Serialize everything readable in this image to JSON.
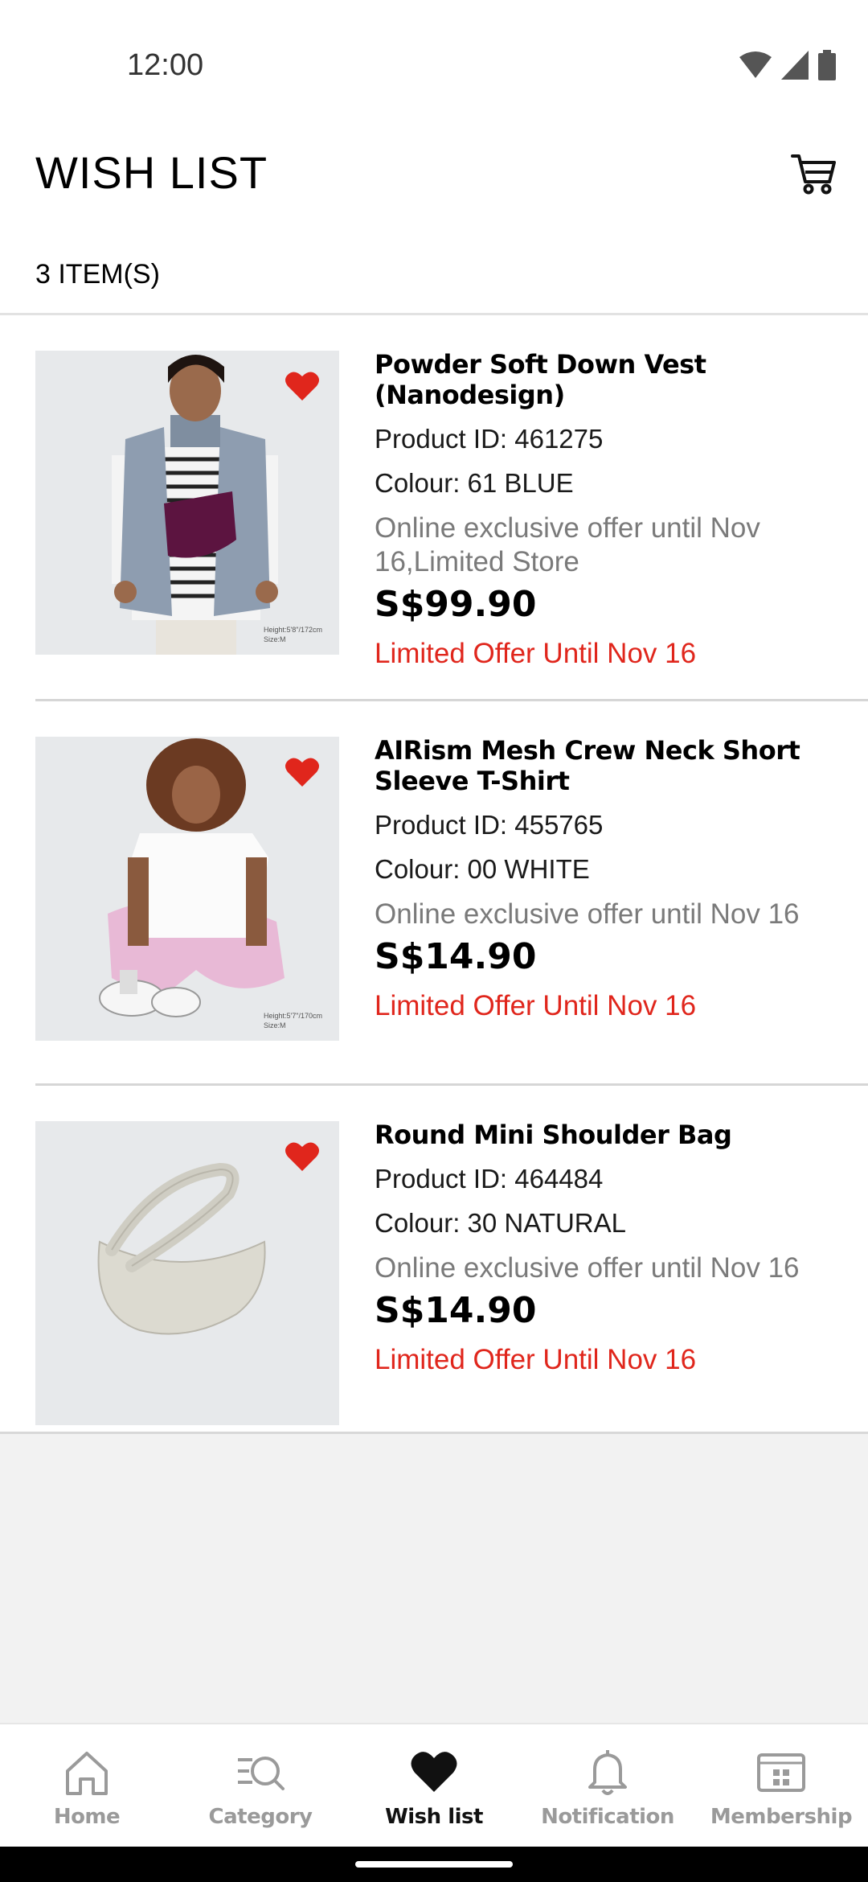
{
  "status_bar": {
    "time": "12:00"
  },
  "header": {
    "title": "WISH LIST",
    "cart_icon": "cart-icon"
  },
  "wishlist": {
    "count_label": "3 ITEM(S)",
    "items": [
      {
        "name": "Powder Soft Down Vest (Nanodesign)",
        "product_id": "Product ID: 461275",
        "colour": "Colour: 61 BLUE",
        "offer": "Online exclusive offer until Nov 16,Limited Store",
        "price": "S$99.90",
        "promo": "Limited Offer Until Nov 16",
        "photo_caption": "Height:5'8\"/172cm Size:M"
      },
      {
        "name": "AIRism Mesh Crew Neck Short Sleeve T-Shirt",
        "product_id": "Product ID: 455765",
        "colour": "Colour: 00 WHITE",
        "offer": "Online exclusive offer until Nov 16",
        "price": "S$14.90",
        "promo": "Limited Offer Until Nov 16",
        "photo_caption": "Height:5'7\"/170cm Size:M"
      },
      {
        "name": "Round Mini Shoulder Bag",
        "product_id": "Product ID: 464484",
        "colour": "Colour: 30 NATURAL",
        "offer": "Online exclusive offer until Nov 16",
        "price": "S$14.90",
        "promo": "Limited Offer Until Nov 16"
      }
    ]
  },
  "bottom_nav": {
    "items": [
      {
        "label": "Home",
        "icon": "home-icon",
        "active": false
      },
      {
        "label": "Category",
        "icon": "category-search-icon",
        "active": false
      },
      {
        "label": "Wish list",
        "icon": "heart-icon",
        "active": true
      },
      {
        "label": "Notification",
        "icon": "bell-icon",
        "active": false
      },
      {
        "label": "Membership",
        "icon": "membership-card-icon",
        "active": false
      }
    ]
  },
  "colors": {
    "accent_red": "#e0261c",
    "muted_text": "#7a7a7a",
    "nav_inactive": "#9a9a9a"
  }
}
